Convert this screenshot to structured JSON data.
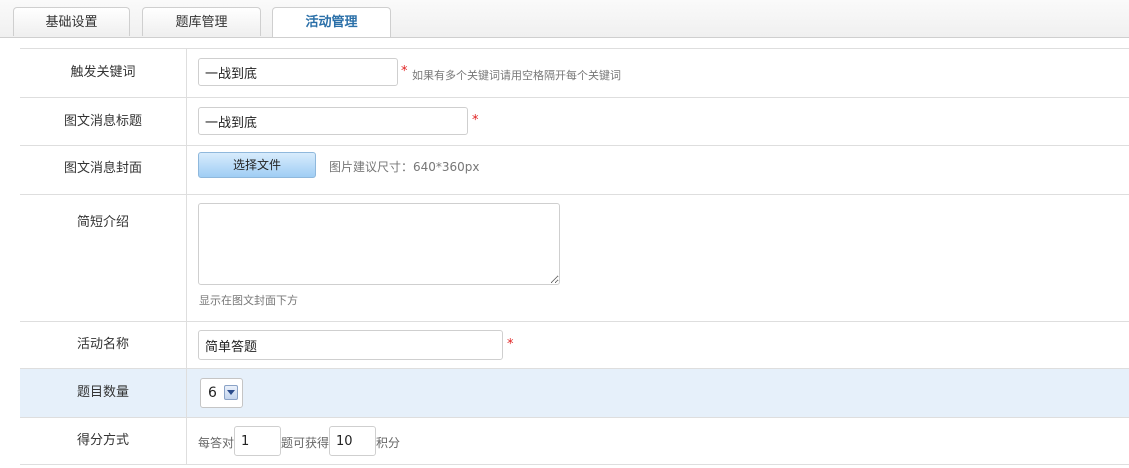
{
  "tabs": [
    {
      "label": "基础设置",
      "active": false
    },
    {
      "label": "题库管理",
      "active": false
    },
    {
      "label": "活动管理",
      "active": true
    }
  ],
  "form": {
    "keyword": {
      "label": "触发关键词",
      "value": "一战到底",
      "required_mark": "*",
      "hint": "如果有多个关键词请用空格隔开每个关键词"
    },
    "title": {
      "label": "图文消息标题",
      "value": "一战到底",
      "required_mark": "*"
    },
    "cover": {
      "label": "图文消息封面",
      "button": "选择文件",
      "hint": "图片建议尺寸：640*360px"
    },
    "intro": {
      "label": "简短介绍",
      "value": "",
      "hint": "显示在图文封面下方"
    },
    "activity_name": {
      "label": "活动名称",
      "value": "简单答题",
      "required_mark": "*"
    },
    "question_count": {
      "label": "题目数量",
      "value": "6"
    },
    "scoring": {
      "label": "得分方式",
      "prefix": "每答对",
      "per_value": "1",
      "middle": "题可获得",
      "points_value": "10",
      "suffix": "积分"
    }
  },
  "colors": {
    "highlight_row": "#e6f0fa",
    "active_tab_text": "#2a6fa8",
    "required": "#e02020"
  }
}
